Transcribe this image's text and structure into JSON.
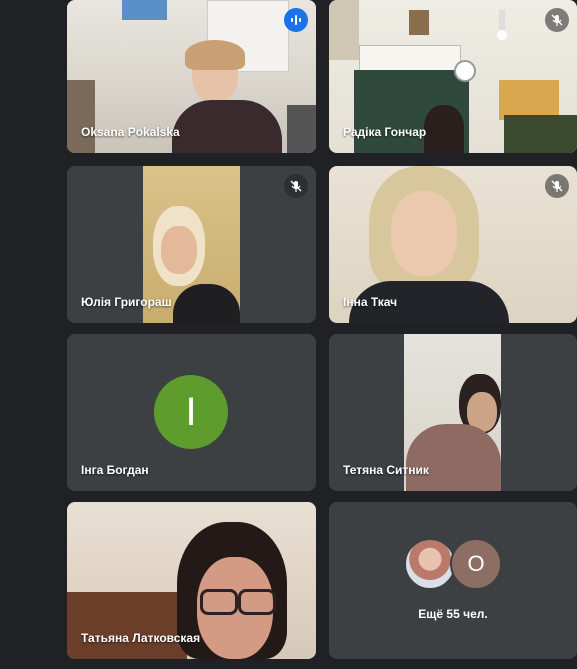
{
  "participants": [
    {
      "name": "Oksana Pokalska",
      "mic_state": "speaking"
    },
    {
      "name": "Радіка Гончар",
      "mic_state": "muted"
    },
    {
      "name": "Юлія Григораш",
      "mic_state": "muted"
    },
    {
      "name": "Інна Ткач",
      "mic_state": "muted"
    },
    {
      "name": "Інга Богдан",
      "avatar_letter": "I",
      "avatar_color": "#5e9c2e"
    },
    {
      "name": "Тетяна Ситник"
    },
    {
      "name": "Татьяна Латковская"
    }
  ],
  "overflow": {
    "avatar_letter": "O",
    "avatar_color": "#8d6e63",
    "label": "Ещё 55 чел."
  },
  "colors": {
    "background": "#202124",
    "tile": "#3c4043",
    "active_border": "#8ab4f8",
    "speaking": "#1a73e8"
  }
}
